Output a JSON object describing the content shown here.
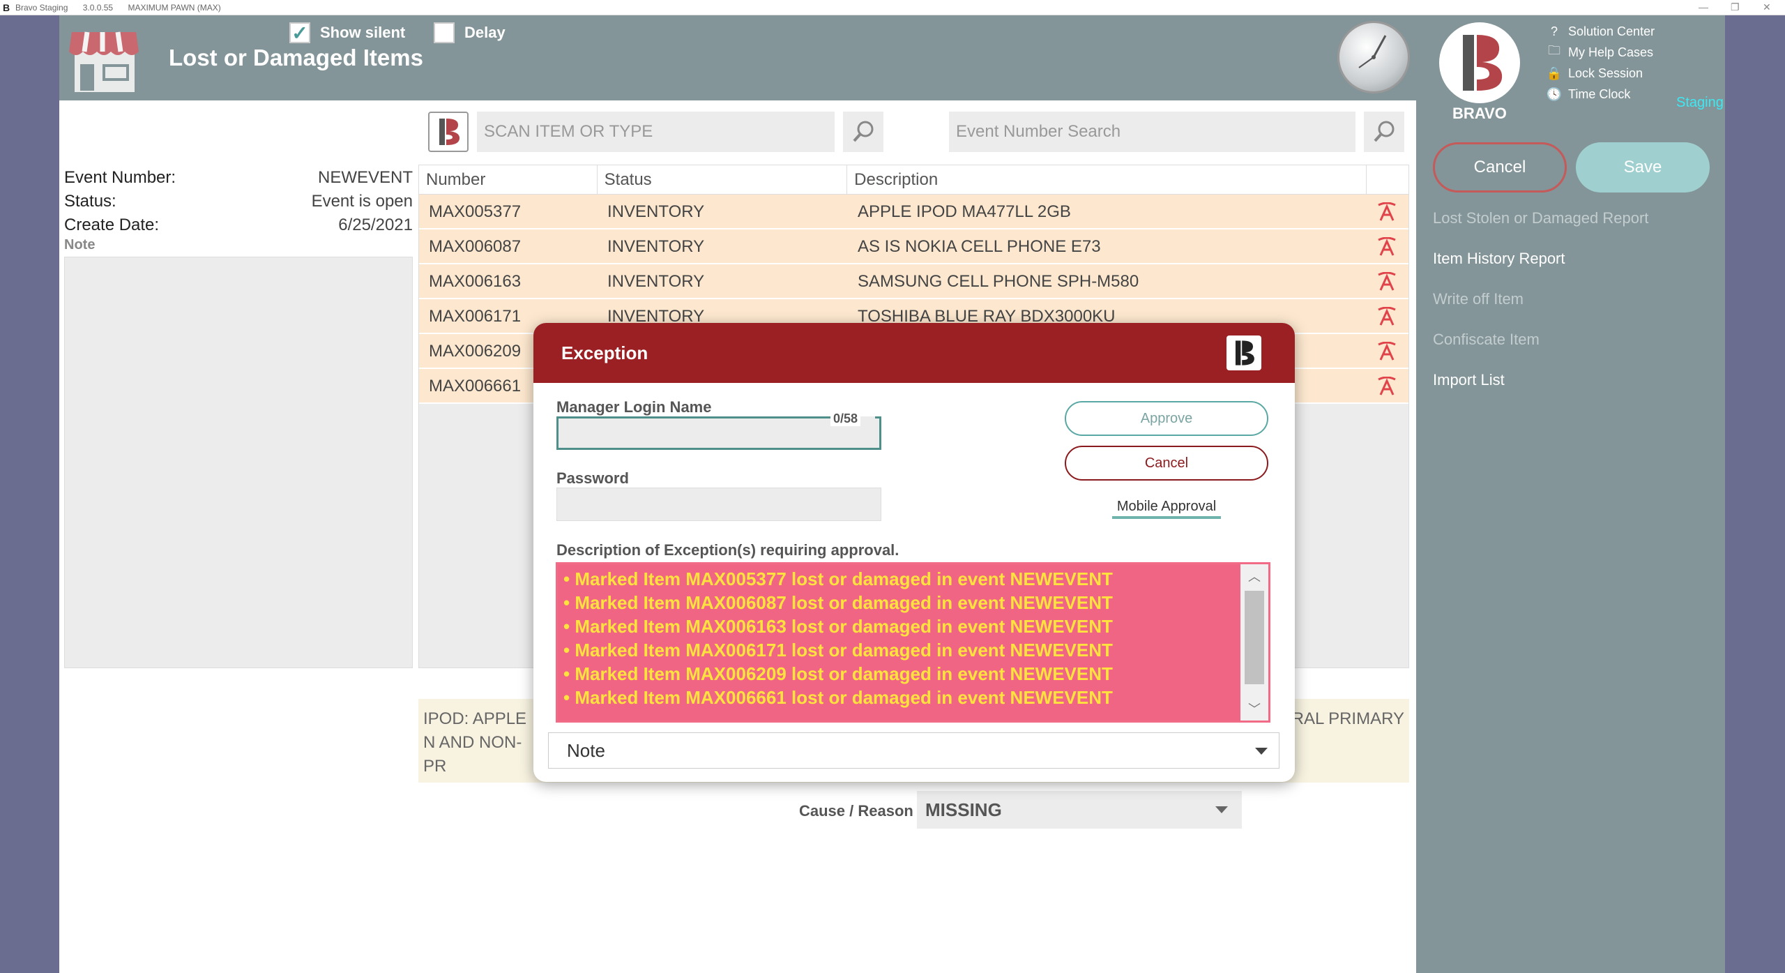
{
  "window": {
    "app_name": "Bravo Staging",
    "version": "3.0.0.55",
    "store": "MAXIMUM PAWN (MAX)"
  },
  "header": {
    "title": "Lost or Damaged Items",
    "show_silent_label": "Show silent",
    "show_silent_checked": true,
    "delay_label": "Delay",
    "delay_checked": false
  },
  "right_panel": {
    "brand_label": "BRAVO",
    "staging_label": "Staging",
    "help_links": [
      {
        "label": "Solution Center",
        "icon": "question-circle-icon"
      },
      {
        "label": "My Help Cases",
        "icon": "folder-icon"
      },
      {
        "label": "Lock Session",
        "icon": "lock-icon"
      },
      {
        "label": "Time Clock",
        "icon": "clock-icon"
      }
    ],
    "cancel_label": "Cancel",
    "save_label": "Save",
    "menu": [
      {
        "label": "Lost Stolen or Damaged Report",
        "enabled": false
      },
      {
        "label": "Item History Report",
        "enabled": true
      },
      {
        "label": "Write off Item",
        "enabled": false
      },
      {
        "label": "Confiscate Item",
        "enabled": false
      },
      {
        "label": "Import List",
        "enabled": true
      }
    ]
  },
  "search": {
    "scan_placeholder": "SCAN ITEM OR TYPE",
    "event_placeholder": "Event Number Search"
  },
  "event": {
    "number_label": "Event Number:",
    "number_value": "NEWEVENT",
    "status_label": "Status:",
    "status_value": "Event is open",
    "create_date_label": "Create Date:",
    "create_date_value": "6/25/2021",
    "note_label": "Note"
  },
  "table": {
    "headers": [
      "Number",
      "Status",
      "Description"
    ],
    "rows": [
      {
        "number": "MAX005377",
        "status": "INVENTORY",
        "description": "APPLE IPOD MA477LL 2GB"
      },
      {
        "number": "MAX006087",
        "status": "INVENTORY",
        "description": "AS IS NOKIA CELL PHONE E73"
      },
      {
        "number": "MAX006163",
        "status": "INVENTORY",
        "description": "SAMSUNG CELL PHONE SPH-M580"
      },
      {
        "number": "MAX006171",
        "status": "INVENTORY",
        "description": "TOSHIBA BLUE RAY BDX3000KU"
      },
      {
        "number": "MAX006209",
        "status": "",
        "description": ""
      },
      {
        "number": "MAX006661",
        "status": "",
        "description": ""
      }
    ]
  },
  "detail": {
    "left_text": "IPOD: APPLE N AND NON-PR",
    "right_text": "RAL PRIMARY",
    "cause_label": "Cause / Reason",
    "cause_value": "MISSING"
  },
  "modal": {
    "title": "Exception",
    "login_label": "Manager Login Name",
    "login_counter": "0/58",
    "password_label": "Password",
    "approve_label": "Approve",
    "cancel_label": "Cancel",
    "mobile_approval_label": "Mobile Approval",
    "exceptions_label": "Description of Exception(s) requiring approval.",
    "exceptions": [
      "• Marked Item MAX005377 lost or damaged in event NEWEVENT",
      "• Marked Item MAX006087 lost or damaged in event NEWEVENT",
      "• Marked Item MAX006163 lost or damaged in event NEWEVENT",
      "• Marked Item MAX006171 lost or damaged in event NEWEVENT",
      "• Marked Item MAX006209 lost or damaged in event NEWEVENT",
      "• Marked Item MAX006661 lost or damaged in event NEWEVENT"
    ],
    "note_select_value": "Note"
  },
  "colors": {
    "header_bg": "#839598",
    "modal_header": "#9a2023",
    "exception_bg": "#f06584",
    "exception_text": "#ffe23e",
    "row_bg": "#fde8cf",
    "staging": "#3ee8f2"
  }
}
